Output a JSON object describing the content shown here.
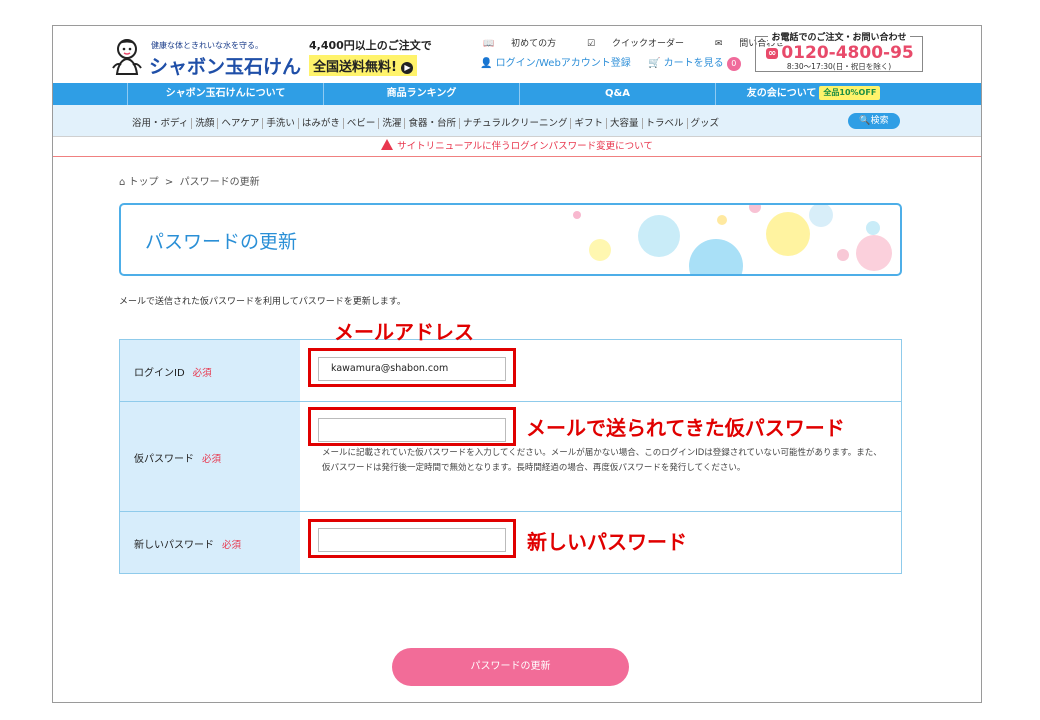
{
  "header": {
    "logo_tagline": "健康な体ときれいな水を守る。",
    "logo_name": "シャボン玉石けん",
    "shipping_top": "4,400円以上のご注文で",
    "shipping_main": "全国送料無料!",
    "top_links": [
      "初めての方",
      "クイックオーダー",
      "問い合わせ"
    ],
    "login_link": "ログイン/Webアカウント登録",
    "cart_link": "カートを見る",
    "cart_count": "0",
    "phone_title": "お電話でのご注文・お問い合わせ",
    "phone_number": "0120-4800-95",
    "phone_hours": "8:30～17:30(日・祝日を除く)"
  },
  "nav": {
    "items": [
      "シャボン玉石けんについて",
      "商品ランキング",
      "Q&A",
      "友の会について"
    ],
    "badge": "全品10%OFF"
  },
  "subnav": {
    "items": [
      "浴用・ボディ",
      "洗顔",
      "ヘアケア",
      "手洗い",
      "はみがき",
      "ベビー",
      "洗濯",
      "食器・台所",
      "ナチュラルクリーニング",
      "ギフト",
      "大容量",
      "トラベル",
      "グッズ"
    ],
    "search_label": "検索"
  },
  "notice": "サイトリニューアルに伴うログインパスワード変更について",
  "breadcrumb": {
    "home": "トップ",
    "separator": ">",
    "current": "パスワードの更新"
  },
  "page_title": "パスワードの更新",
  "intro": "メールで送信された仮パスワードを利用してパスワードを更新します。",
  "form": {
    "required_label": "必須",
    "login_id_label": "ログインID",
    "login_id_value": "kawamura@shabon.com",
    "temp_password_label": "仮パスワード",
    "temp_password_help": "メールに記載されていた仮パスワードを入力してください。メールが届かない場合、このログインIDは登録されていない可能性があります。また、仮パスワードは発行後一定時間で無効となります。長時間経過の場合、再度仮パスワードを発行してください。",
    "new_password_label": "新しいパスワード",
    "submit_label": "パスワードの更新"
  },
  "annotations": {
    "email": "メールアドレス",
    "temp_password": "メールで送られてきた仮パスワード",
    "new_password": "新しいパスワード"
  },
  "colors": {
    "brand_blue": "#2f9ee5",
    "accent_pink": "#f26c98",
    "annotation_red": "#e00000"
  }
}
